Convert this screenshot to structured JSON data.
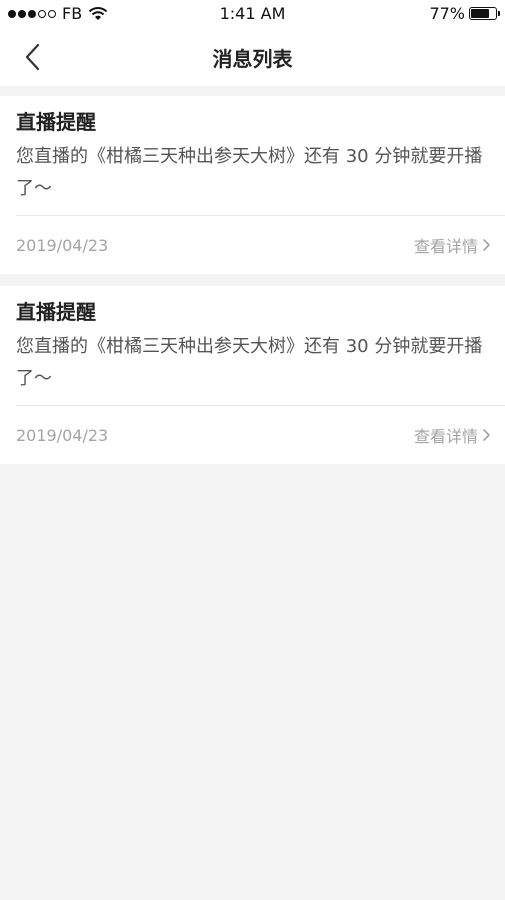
{
  "status_bar": {
    "carrier": "FB",
    "time": "1:41 AM",
    "battery_text": "77%",
    "battery_level": 0.77
  },
  "nav": {
    "title": "消息列表"
  },
  "messages": [
    {
      "title": "直播提醒",
      "content": "您直播的《柑橘三天种出参天大树》还有 30 分钟就要开播了～",
      "date": "2019/04/23",
      "detail_label": "查看详情"
    },
    {
      "title": "直播提醒",
      "content": "您直播的《柑橘三天种出参天大树》还有 30 分钟就要开播了～",
      "date": "2019/04/23",
      "detail_label": "查看详情"
    }
  ],
  "colors": {
    "background": "#f3f3f3",
    "card": "#ffffff",
    "secondary_text": "#a4a4a4"
  }
}
